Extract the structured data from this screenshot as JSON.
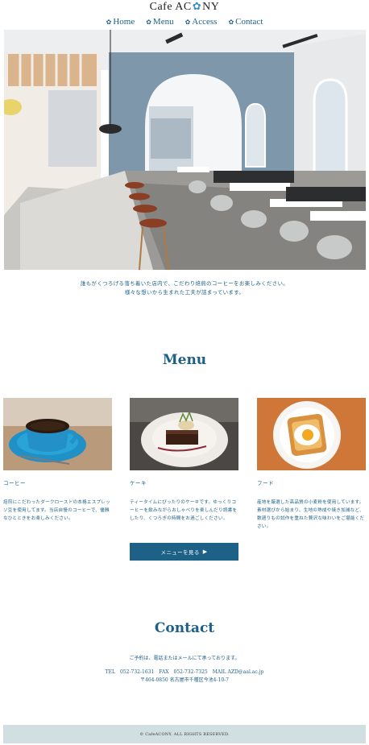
{
  "header": {
    "logo_left": "Cafe AC",
    "logo_right": "NY",
    "nav": [
      {
        "label": "Home"
      },
      {
        "label": "Menu"
      },
      {
        "label": "Access"
      },
      {
        "label": "Contact"
      }
    ]
  },
  "intro": {
    "line1": "誰もがくつろげる落ち着いた店内で、こだわり焙煎のコーヒーをお楽しみください。",
    "line2": "様々な想いから生まれた工夫が詰まっています。"
  },
  "menu": {
    "title": "Menu",
    "items": [
      {
        "name": "コーヒー",
        "desc": "焙煎にこだわったダークローストの本格エスプレッソ豆を使用してます。当店自慢のコーヒーで、優雅なひとときをお楽しみください。"
      },
      {
        "name": "ケーキ",
        "desc": "ティータイムにぴったりのケーキです。ゆっくりコーヒーを飲みながらおしゃべりを楽しんだり読書をしたり、くつろぎの時間をお過ごしください。"
      },
      {
        "name": "フード",
        "desc": "産地を厳選した高品質の小麦粉を使用しています。　素材選びから始まり、生地の熟成や焼き加減など、数週りもの試作を重ねた贅沢な味わいをご堪能ください。"
      }
    ],
    "more_label": "メニューを見る"
  },
  "contact": {
    "title": "Contact",
    "lead": "ご予約は、電話またはメールにて承っております。",
    "tel_line": "TEL　052-732-1631　FAX　052-732-7325　MAIL AZD@aal.ac.jp",
    "address": "〒464-0850 名古屋市千種区今池4-10-7"
  },
  "footer": {
    "copyright": "© CafeACONY, ALL RIGHTS RESERVED."
  },
  "colors": {
    "accent": "#1d6186",
    "footer_bg": "#d1dfe3"
  }
}
